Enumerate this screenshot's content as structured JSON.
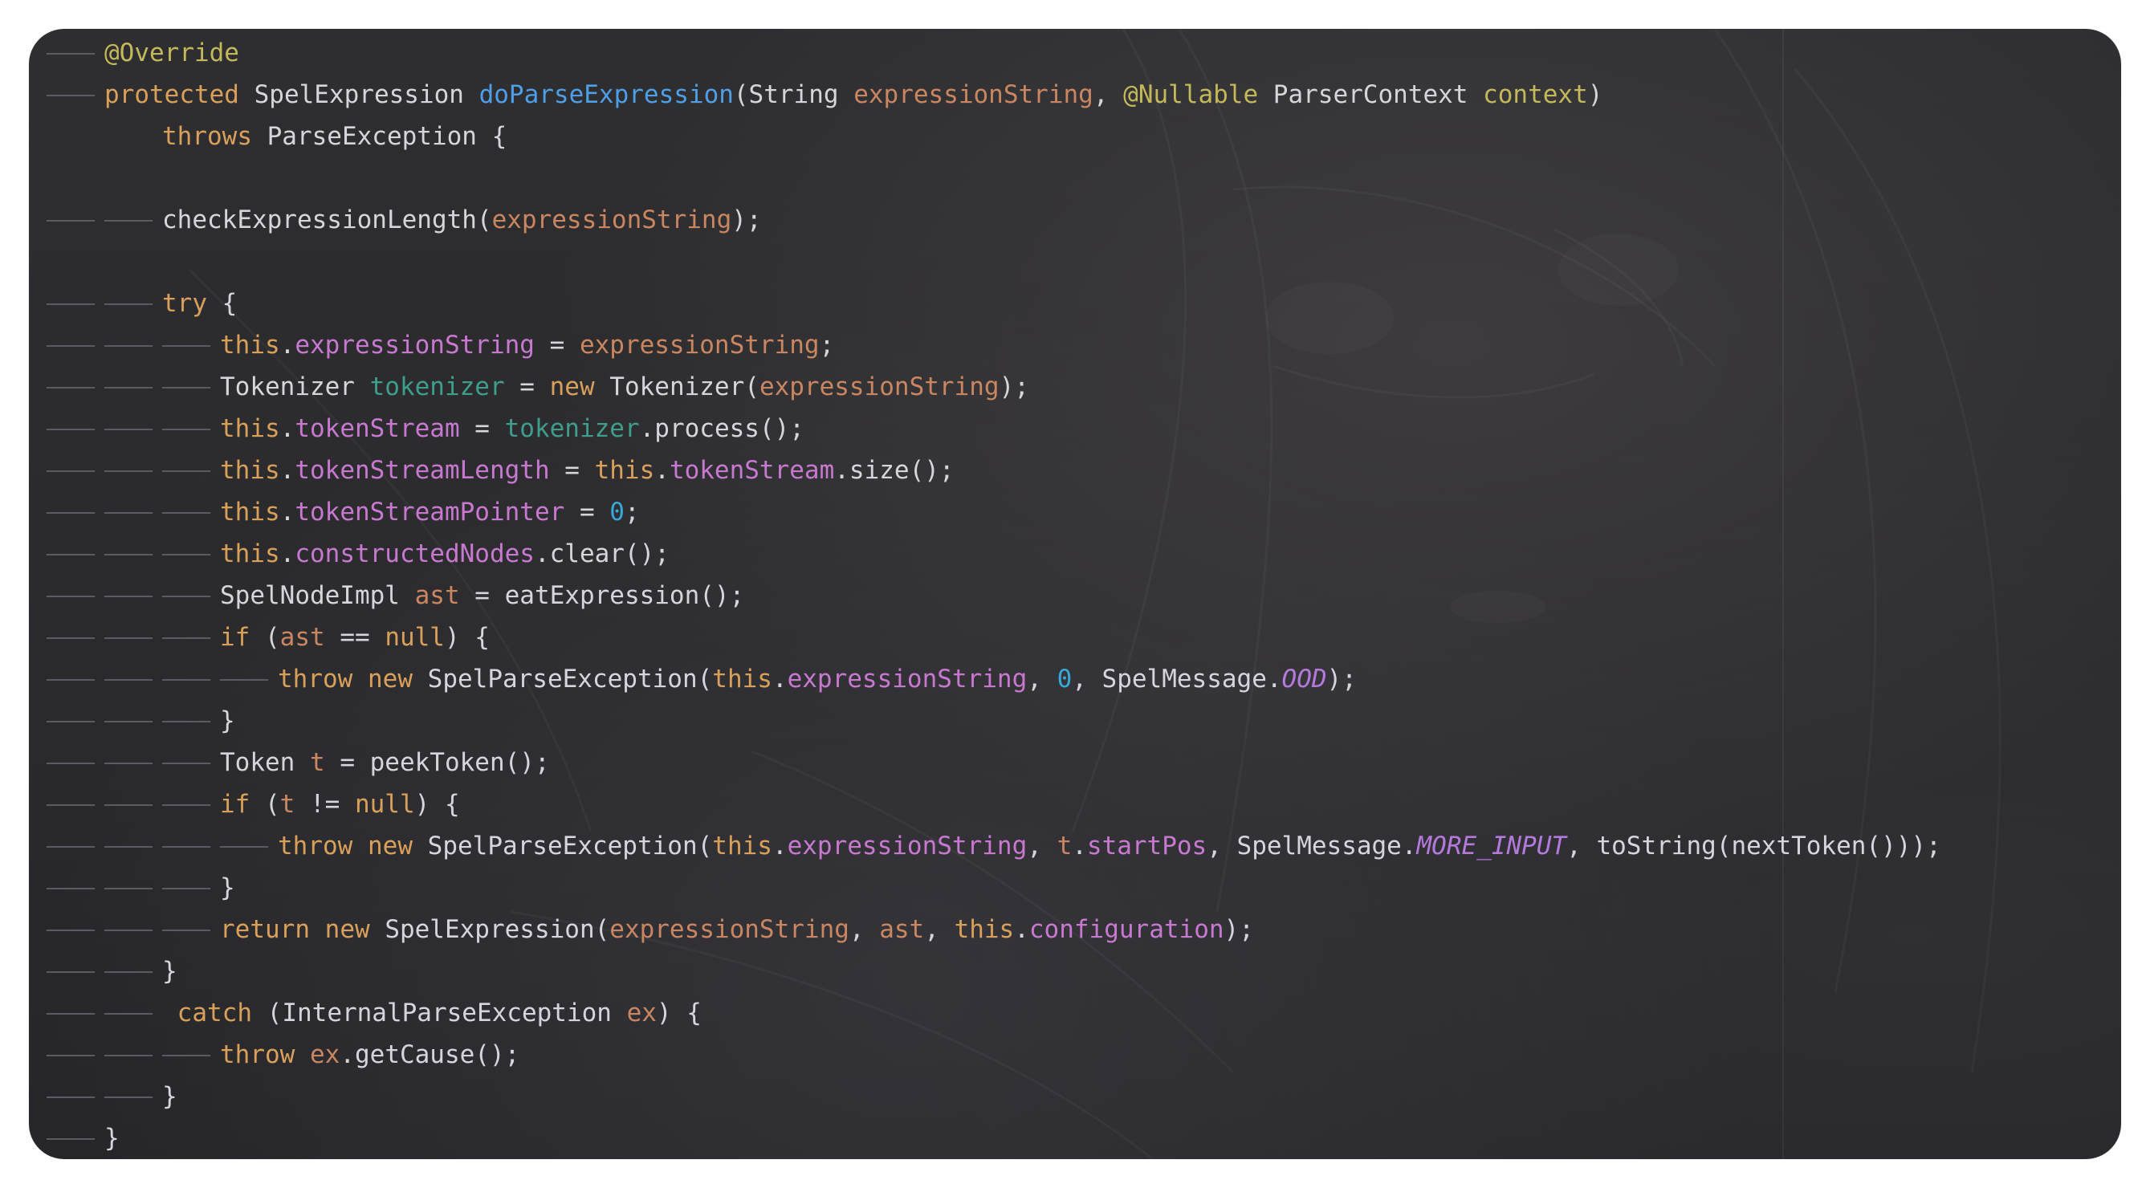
{
  "editor": {
    "lines": [
      {
        "indent": 1,
        "tokens": [
          {
            "t": "@Override",
            "c": "ann"
          }
        ]
      },
      {
        "indent": 1,
        "tokens": [
          {
            "t": "protected",
            "c": "kw"
          },
          {
            "t": " SpelExpression ",
            "c": "ty"
          },
          {
            "t": "doParseExpression",
            "c": "fn"
          },
          {
            "t": "(String ",
            "c": "ty"
          },
          {
            "t": "expressionString",
            "c": "par"
          },
          {
            "t": ", ",
            "c": "ty"
          },
          {
            "t": "@Nullable",
            "c": "ann"
          },
          {
            "t": " ParserContext ",
            "c": "ty"
          },
          {
            "t": "context",
            "c": "ann"
          },
          {
            "t": ")",
            "c": "ty"
          }
        ]
      },
      {
        "indent": 0,
        "pad": 2,
        "tokens": [
          {
            "t": "throws",
            "c": "kw"
          },
          {
            "t": " ParseException {",
            "c": "ty"
          }
        ]
      },
      {
        "indent": 0,
        "tokens": []
      },
      {
        "indent": 2,
        "tokens": [
          {
            "t": "checkExpressionLength(",
            "c": "ty"
          },
          {
            "t": "expressionString",
            "c": "par"
          },
          {
            "t": ");",
            "c": "ty"
          }
        ]
      },
      {
        "indent": 0,
        "tokens": []
      },
      {
        "indent": 2,
        "tokens": [
          {
            "t": "try",
            "c": "kw"
          },
          {
            "t": " {",
            "c": "ty"
          }
        ]
      },
      {
        "indent": 3,
        "tokens": [
          {
            "t": "this",
            "c": "kw"
          },
          {
            "t": ".",
            "c": "ty"
          },
          {
            "t": "expressionString",
            "c": "fld"
          },
          {
            "t": " = ",
            "c": "ty"
          },
          {
            "t": "expressionString",
            "c": "par"
          },
          {
            "t": ";",
            "c": "ty"
          }
        ]
      },
      {
        "indent": 3,
        "tokens": [
          {
            "t": "Tokenizer ",
            "c": "ty"
          },
          {
            "t": "tokenizer",
            "c": "loc"
          },
          {
            "t": " = ",
            "c": "ty"
          },
          {
            "t": "new",
            "c": "kw"
          },
          {
            "t": " Tokenizer(",
            "c": "ty"
          },
          {
            "t": "expressionString",
            "c": "par"
          },
          {
            "t": ");",
            "c": "ty"
          }
        ]
      },
      {
        "indent": 3,
        "tokens": [
          {
            "t": "this",
            "c": "kw"
          },
          {
            "t": ".",
            "c": "ty"
          },
          {
            "t": "tokenStream",
            "c": "fld"
          },
          {
            "t": " = ",
            "c": "ty"
          },
          {
            "t": "tokenizer",
            "c": "loc"
          },
          {
            "t": ".process();",
            "c": "ty"
          }
        ]
      },
      {
        "indent": 3,
        "tokens": [
          {
            "t": "this",
            "c": "kw"
          },
          {
            "t": ".",
            "c": "ty"
          },
          {
            "t": "tokenStreamLength",
            "c": "fld"
          },
          {
            "t": " = ",
            "c": "ty"
          },
          {
            "t": "this",
            "c": "kw"
          },
          {
            "t": ".",
            "c": "ty"
          },
          {
            "t": "tokenStream",
            "c": "fld"
          },
          {
            "t": ".size();",
            "c": "ty"
          }
        ]
      },
      {
        "indent": 3,
        "tokens": [
          {
            "t": "this",
            "c": "kw"
          },
          {
            "t": ".",
            "c": "ty"
          },
          {
            "t": "tokenStreamPointer",
            "c": "fld"
          },
          {
            "t": " = ",
            "c": "ty"
          },
          {
            "t": "0",
            "c": "num"
          },
          {
            "t": ";",
            "c": "ty"
          }
        ]
      },
      {
        "indent": 3,
        "tokens": [
          {
            "t": "this",
            "c": "kw"
          },
          {
            "t": ".",
            "c": "ty"
          },
          {
            "t": "constructedNodes",
            "c": "fld"
          },
          {
            "t": ".clear();",
            "c": "ty"
          }
        ]
      },
      {
        "indent": 3,
        "tokens": [
          {
            "t": "SpelNodeImpl ",
            "c": "ty"
          },
          {
            "t": "ast",
            "c": "par"
          },
          {
            "t": " = eatExpression();",
            "c": "ty"
          }
        ]
      },
      {
        "indent": 3,
        "tokens": [
          {
            "t": "if",
            "c": "kw"
          },
          {
            "t": " (",
            "c": "ty"
          },
          {
            "t": "ast",
            "c": "par"
          },
          {
            "t": " == ",
            "c": "ty"
          },
          {
            "t": "null",
            "c": "kw"
          },
          {
            "t": ") {",
            "c": "ty"
          }
        ]
      },
      {
        "indent": 4,
        "tokens": [
          {
            "t": "throw",
            "c": "kw"
          },
          {
            "t": " ",
            "c": "ty"
          },
          {
            "t": "new",
            "c": "kw"
          },
          {
            "t": " SpelParseException(",
            "c": "ty"
          },
          {
            "t": "this",
            "c": "kw"
          },
          {
            "t": ".",
            "c": "ty"
          },
          {
            "t": "expressionString",
            "c": "fld"
          },
          {
            "t": ", ",
            "c": "ty"
          },
          {
            "t": "0",
            "c": "num"
          },
          {
            "t": ", SpelMessage.",
            "c": "ty"
          },
          {
            "t": "OOD",
            "c": "cst"
          },
          {
            "t": ");",
            "c": "ty"
          }
        ]
      },
      {
        "indent": 3,
        "tokens": [
          {
            "t": "}",
            "c": "ty"
          }
        ]
      },
      {
        "indent": 3,
        "tokens": [
          {
            "t": "Token ",
            "c": "ty"
          },
          {
            "t": "t",
            "c": "par"
          },
          {
            "t": " = peekToken();",
            "c": "ty"
          }
        ]
      },
      {
        "indent": 3,
        "tokens": [
          {
            "t": "if",
            "c": "kw"
          },
          {
            "t": " (",
            "c": "ty"
          },
          {
            "t": "t",
            "c": "par"
          },
          {
            "t": " != ",
            "c": "ty"
          },
          {
            "t": "null",
            "c": "kw"
          },
          {
            "t": ") {",
            "c": "ty"
          }
        ]
      },
      {
        "indent": 4,
        "tokens": [
          {
            "t": "throw",
            "c": "kw"
          },
          {
            "t": " ",
            "c": "ty"
          },
          {
            "t": "new",
            "c": "kw"
          },
          {
            "t": " SpelParseException(",
            "c": "ty"
          },
          {
            "t": "this",
            "c": "kw"
          },
          {
            "t": ".",
            "c": "ty"
          },
          {
            "t": "expressionString",
            "c": "fld"
          },
          {
            "t": ", ",
            "c": "ty"
          },
          {
            "t": "t",
            "c": "par"
          },
          {
            "t": ".",
            "c": "ty"
          },
          {
            "t": "startPos",
            "c": "fld"
          },
          {
            "t": ", SpelMessage.",
            "c": "ty"
          },
          {
            "t": "MORE_INPUT",
            "c": "cst"
          },
          {
            "t": ", toString(nextToken()));",
            "c": "ty"
          }
        ]
      },
      {
        "indent": 3,
        "tokens": [
          {
            "t": "}",
            "c": "ty"
          }
        ]
      },
      {
        "indent": 3,
        "tokens": [
          {
            "t": "return",
            "c": "kw"
          },
          {
            "t": " ",
            "c": "ty"
          },
          {
            "t": "new",
            "c": "kw"
          },
          {
            "t": " SpelExpression(",
            "c": "ty"
          },
          {
            "t": "expressionString",
            "c": "par"
          },
          {
            "t": ", ",
            "c": "ty"
          },
          {
            "t": "ast",
            "c": "par"
          },
          {
            "t": ", ",
            "c": "ty"
          },
          {
            "t": "this",
            "c": "kw"
          },
          {
            "t": ".",
            "c": "ty"
          },
          {
            "t": "configuration",
            "c": "fld"
          },
          {
            "t": ");",
            "c": "ty"
          }
        ]
      },
      {
        "indent": 2,
        "tokens": [
          {
            "t": "}",
            "c": "ty"
          }
        ]
      },
      {
        "indent": 2,
        "lead": " ",
        "tokens": [
          {
            "t": "catch",
            "c": "kw"
          },
          {
            "t": " (InternalParseException ",
            "c": "ty"
          },
          {
            "t": "ex",
            "c": "par"
          },
          {
            "t": ") {",
            "c": "ty"
          }
        ]
      },
      {
        "indent": 3,
        "tokens": [
          {
            "t": "throw",
            "c": "kw"
          },
          {
            "t": " ",
            "c": "ty"
          },
          {
            "t": "ex",
            "c": "par"
          },
          {
            "t": ".getCause();",
            "c": "ty"
          }
        ]
      },
      {
        "indent": 2,
        "tokens": [
          {
            "t": "}",
            "c": "ty"
          }
        ]
      },
      {
        "indent": 1,
        "tokens": [
          {
            "t": "}",
            "c": "ty"
          }
        ]
      }
    ]
  },
  "colors": {
    "keyword": "#d8a05a",
    "annotation": "#c3b85a",
    "method": "#4f9fe8",
    "parameter": "#c98661",
    "field": "#c779d0",
    "local": "#3f9d8c",
    "number": "#37a8d8",
    "constant": "#b37adb",
    "text": "#d4d6dc",
    "background": "#2b2b2e"
  }
}
